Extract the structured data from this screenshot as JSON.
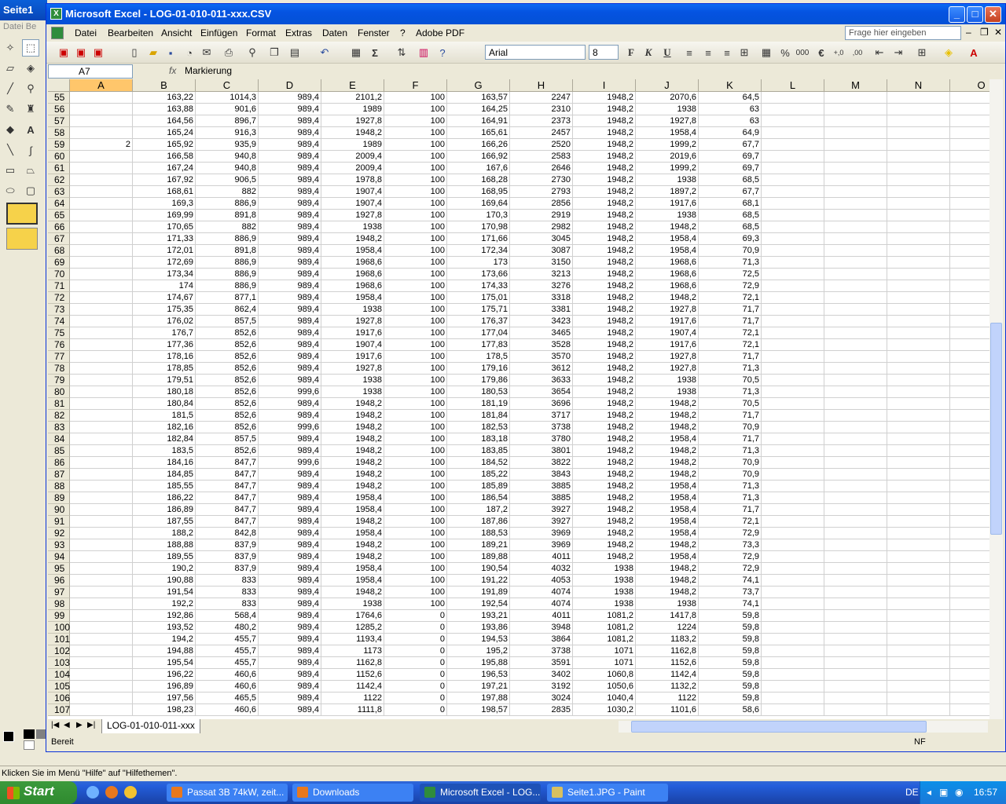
{
  "paint": {
    "title": "Seite1",
    "menu": "Datei  Be",
    "status": "Klicken Sie im Menü \"Hilfe\" auf \"Hilfethemen\"."
  },
  "excel": {
    "title": "Microsoft Excel - LOG-01-010-011-xxx.CSV",
    "menu": [
      "Datei",
      "Bearbeiten",
      "Ansicht",
      "Einfügen",
      "Format",
      "Extras",
      "Daten",
      "Fenster",
      "?",
      "Adobe PDF"
    ],
    "help_placeholder": "Frage hier eingeben",
    "font": "Arial",
    "font_size": "8",
    "namebox": "A7",
    "formula": "Markierung",
    "columns": [
      "A",
      "B",
      "C",
      "D",
      "E",
      "F",
      "G",
      "H",
      "I",
      "J",
      "K",
      "L",
      "M",
      "N",
      "O"
    ],
    "rows": [
      [
        "55",
        "",
        "163,22",
        "1014,3",
        "989,4",
        "2101,2",
        "100",
        "163,57",
        "2247",
        "1948,2",
        "2070,6",
        "64,5"
      ],
      [
        "56",
        "",
        "163,88",
        "901,6",
        "989,4",
        "1989",
        "100",
        "164,25",
        "2310",
        "1948,2",
        "1938",
        "63"
      ],
      [
        "57",
        "",
        "164,56",
        "896,7",
        "989,4",
        "1927,8",
        "100",
        "164,91",
        "2373",
        "1948,2",
        "1927,8",
        "63"
      ],
      [
        "58",
        "",
        "165,24",
        "916,3",
        "989,4",
        "1948,2",
        "100",
        "165,61",
        "2457",
        "1948,2",
        "1958,4",
        "64,9"
      ],
      [
        "59",
        "2",
        "165,92",
        "935,9",
        "989,4",
        "1989",
        "100",
        "166,26",
        "2520",
        "1948,2",
        "1999,2",
        "67,7"
      ],
      [
        "60",
        "",
        "166,58",
        "940,8",
        "989,4",
        "2009,4",
        "100",
        "166,92",
        "2583",
        "1948,2",
        "2019,6",
        "69,7"
      ],
      [
        "61",
        "",
        "167,24",
        "940,8",
        "989,4",
        "2009,4",
        "100",
        "167,6",
        "2646",
        "1948,2",
        "1999,2",
        "69,7"
      ],
      [
        "62",
        "",
        "167,92",
        "906,5",
        "989,4",
        "1978,8",
        "100",
        "168,28",
        "2730",
        "1948,2",
        "1938",
        "68,5"
      ],
      [
        "63",
        "",
        "168,61",
        "882",
        "989,4",
        "1907,4",
        "100",
        "168,95",
        "2793",
        "1948,2",
        "1897,2",
        "67,7"
      ],
      [
        "64",
        "",
        "169,3",
        "886,9",
        "989,4",
        "1907,4",
        "100",
        "169,64",
        "2856",
        "1948,2",
        "1917,6",
        "68,1"
      ],
      [
        "65",
        "",
        "169,99",
        "891,8",
        "989,4",
        "1927,8",
        "100",
        "170,3",
        "2919",
        "1948,2",
        "1938",
        "68,5"
      ],
      [
        "66",
        "",
        "170,65",
        "882",
        "989,4",
        "1938",
        "100",
        "170,98",
        "2982",
        "1948,2",
        "1948,2",
        "68,5"
      ],
      [
        "67",
        "",
        "171,33",
        "886,9",
        "989,4",
        "1948,2",
        "100",
        "171,66",
        "3045",
        "1948,2",
        "1958,4",
        "69,3"
      ],
      [
        "68",
        "",
        "172,01",
        "891,8",
        "989,4",
        "1958,4",
        "100",
        "172,34",
        "3087",
        "1948,2",
        "1958,4",
        "70,9"
      ],
      [
        "69",
        "",
        "172,69",
        "886,9",
        "989,4",
        "1968,6",
        "100",
        "173",
        "3150",
        "1948,2",
        "1968,6",
        "71,3"
      ],
      [
        "70",
        "",
        "173,34",
        "886,9",
        "989,4",
        "1968,6",
        "100",
        "173,66",
        "3213",
        "1948,2",
        "1968,6",
        "72,5"
      ],
      [
        "71",
        "",
        "174",
        "886,9",
        "989,4",
        "1968,6",
        "100",
        "174,33",
        "3276",
        "1948,2",
        "1968,6",
        "72,9"
      ],
      [
        "72",
        "",
        "174,67",
        "877,1",
        "989,4",
        "1958,4",
        "100",
        "175,01",
        "3318",
        "1948,2",
        "1948,2",
        "72,1"
      ],
      [
        "73",
        "",
        "175,35",
        "862,4",
        "989,4",
        "1938",
        "100",
        "175,71",
        "3381",
        "1948,2",
        "1927,8",
        "71,7"
      ],
      [
        "74",
        "",
        "176,02",
        "857,5",
        "989,4",
        "1927,8",
        "100",
        "176,37",
        "3423",
        "1948,2",
        "1917,6",
        "71,7"
      ],
      [
        "75",
        "",
        "176,7",
        "852,6",
        "989,4",
        "1917,6",
        "100",
        "177,04",
        "3465",
        "1948,2",
        "1907,4",
        "72,1"
      ],
      [
        "76",
        "",
        "177,36",
        "852,6",
        "989,4",
        "1907,4",
        "100",
        "177,83",
        "3528",
        "1948,2",
        "1917,6",
        "72,1"
      ],
      [
        "77",
        "",
        "178,16",
        "852,6",
        "989,4",
        "1917,6",
        "100",
        "178,5",
        "3570",
        "1948,2",
        "1927,8",
        "71,7"
      ],
      [
        "78",
        "",
        "178,85",
        "852,6",
        "989,4",
        "1927,8",
        "100",
        "179,16",
        "3612",
        "1948,2",
        "1927,8",
        "71,3"
      ],
      [
        "79",
        "",
        "179,51",
        "852,6",
        "989,4",
        "1938",
        "100",
        "179,86",
        "3633",
        "1948,2",
        "1938",
        "70,5"
      ],
      [
        "80",
        "",
        "180,18",
        "852,6",
        "999,6",
        "1938",
        "100",
        "180,53",
        "3654",
        "1948,2",
        "1938",
        "71,3"
      ],
      [
        "81",
        "",
        "180,84",
        "852,6",
        "989,4",
        "1948,2",
        "100",
        "181,19",
        "3696",
        "1948,2",
        "1948,2",
        "70,5"
      ],
      [
        "82",
        "",
        "181,5",
        "852,6",
        "989,4",
        "1948,2",
        "100",
        "181,84",
        "3717",
        "1948,2",
        "1948,2",
        "71,7"
      ],
      [
        "83",
        "",
        "182,16",
        "852,6",
        "999,6",
        "1948,2",
        "100",
        "182,53",
        "3738",
        "1948,2",
        "1948,2",
        "70,9"
      ],
      [
        "84",
        "",
        "182,84",
        "857,5",
        "989,4",
        "1948,2",
        "100",
        "183,18",
        "3780",
        "1948,2",
        "1958,4",
        "71,7"
      ],
      [
        "85",
        "",
        "183,5",
        "852,6",
        "989,4",
        "1948,2",
        "100",
        "183,85",
        "3801",
        "1948,2",
        "1948,2",
        "71,3"
      ],
      [
        "86",
        "",
        "184,16",
        "847,7",
        "999,6",
        "1948,2",
        "100",
        "184,52",
        "3822",
        "1948,2",
        "1948,2",
        "70,9"
      ],
      [
        "87",
        "",
        "184,85",
        "847,7",
        "989,4",
        "1948,2",
        "100",
        "185,22",
        "3843",
        "1948,2",
        "1948,2",
        "70,9"
      ],
      [
        "88",
        "",
        "185,55",
        "847,7",
        "989,4",
        "1948,2",
        "100",
        "185,89",
        "3885",
        "1948,2",
        "1958,4",
        "71,3"
      ],
      [
        "89",
        "",
        "186,22",
        "847,7",
        "989,4",
        "1958,4",
        "100",
        "186,54",
        "3885",
        "1948,2",
        "1958,4",
        "71,3"
      ],
      [
        "90",
        "",
        "186,89",
        "847,7",
        "989,4",
        "1958,4",
        "100",
        "187,2",
        "3927",
        "1948,2",
        "1958,4",
        "71,7"
      ],
      [
        "91",
        "",
        "187,55",
        "847,7",
        "989,4",
        "1948,2",
        "100",
        "187,86",
        "3927",
        "1948,2",
        "1958,4",
        "72,1"
      ],
      [
        "92",
        "",
        "188,2",
        "842,8",
        "989,4",
        "1958,4",
        "100",
        "188,53",
        "3969",
        "1948,2",
        "1958,4",
        "72,9"
      ],
      [
        "93",
        "",
        "188,88",
        "837,9",
        "989,4",
        "1948,2",
        "100",
        "189,21",
        "3969",
        "1948,2",
        "1948,2",
        "73,3"
      ],
      [
        "94",
        "",
        "189,55",
        "837,9",
        "989,4",
        "1948,2",
        "100",
        "189,88",
        "4011",
        "1948,2",
        "1958,4",
        "72,9"
      ],
      [
        "95",
        "",
        "190,2",
        "837,9",
        "989,4",
        "1958,4",
        "100",
        "190,54",
        "4032",
        "1938",
        "1948,2",
        "72,9"
      ],
      [
        "96",
        "",
        "190,88",
        "833",
        "989,4",
        "1958,4",
        "100",
        "191,22",
        "4053",
        "1938",
        "1948,2",
        "74,1"
      ],
      [
        "97",
        "",
        "191,54",
        "833",
        "989,4",
        "1948,2",
        "100",
        "191,89",
        "4074",
        "1938",
        "1948,2",
        "73,7"
      ],
      [
        "98",
        "",
        "192,2",
        "833",
        "989,4",
        "1938",
        "100",
        "192,54",
        "4074",
        "1938",
        "1938",
        "74,1"
      ],
      [
        "99",
        "",
        "192,86",
        "568,4",
        "989,4",
        "1764,6",
        "0",
        "193,21",
        "4011",
        "1081,2",
        "1417,8",
        "59,8"
      ],
      [
        "100",
        "",
        "193,52",
        "480,2",
        "989,4",
        "1285,2",
        "0",
        "193,86",
        "3948",
        "1081,2",
        "1224",
        "59,8"
      ],
      [
        "101",
        "",
        "194,2",
        "455,7",
        "989,4",
        "1193,4",
        "0",
        "194,53",
        "3864",
        "1081,2",
        "1183,2",
        "59,8"
      ],
      [
        "102",
        "",
        "194,88",
        "455,7",
        "989,4",
        "1173",
        "0",
        "195,2",
        "3738",
        "1071",
        "1162,8",
        "59,8"
      ],
      [
        "103",
        "",
        "195,54",
        "455,7",
        "989,4",
        "1162,8",
        "0",
        "195,88",
        "3591",
        "1071",
        "1152,6",
        "59,8"
      ],
      [
        "104",
        "",
        "196,22",
        "460,6",
        "989,4",
        "1152,6",
        "0",
        "196,53",
        "3402",
        "1060,8",
        "1142,4",
        "59,8"
      ],
      [
        "105",
        "",
        "196,89",
        "460,6",
        "989,4",
        "1142,4",
        "0",
        "197,21",
        "3192",
        "1050,6",
        "1132,2",
        "59,8"
      ],
      [
        "106",
        "",
        "197,56",
        "465,5",
        "989,4",
        "1122",
        "0",
        "197,88",
        "3024",
        "1040,4",
        "1122",
        "59,8"
      ],
      [
        "107",
        "",
        "198,23",
        "460,6",
        "989,4",
        "1111,8",
        "0",
        "198,57",
        "2835",
        "1030,2",
        "1101,6",
        "58,6"
      ]
    ],
    "sheet_tab": "LOG-01-010-011-xxx",
    "status_left": "Bereit",
    "status_right": "NF"
  },
  "taskbar": {
    "start": "Start",
    "tasks": [
      "Passat 3B 74kW, zeit...",
      "Downloads",
      "Microsoft Excel - LOG...",
      "Seite1.JPG - Paint"
    ],
    "lang": "DE",
    "clock": "16:57"
  },
  "colors": {
    "title_blue": "#0553e1",
    "selected_header": "#ffc66b",
    "taskbar": "#245edb",
    "start_green": "#3c9a3c"
  }
}
